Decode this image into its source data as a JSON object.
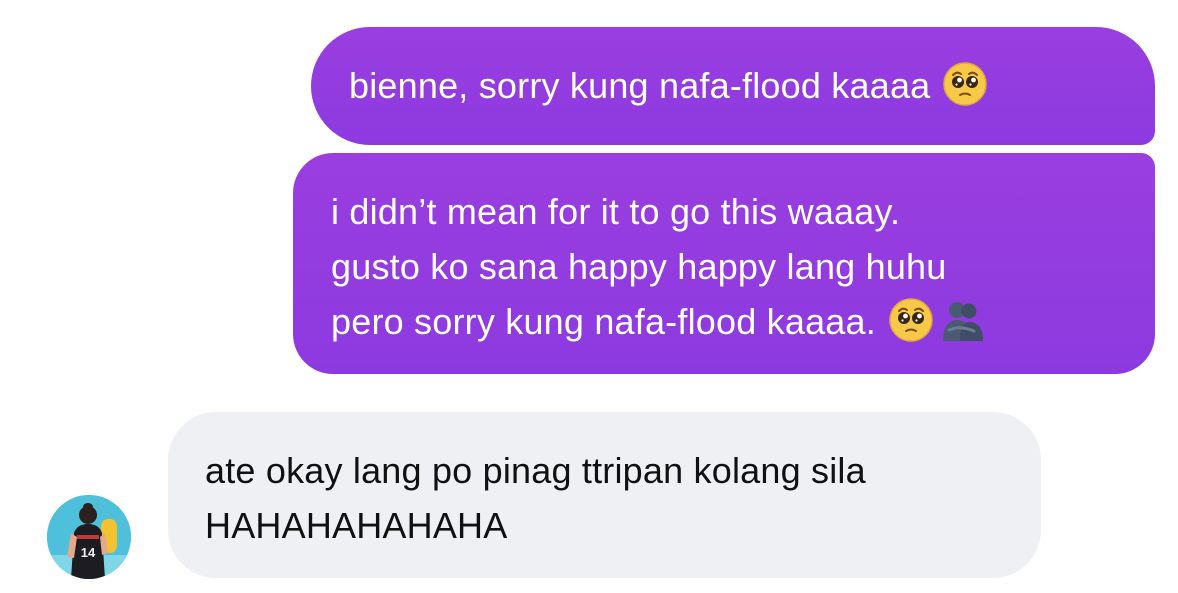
{
  "messages": [
    {
      "sender": "me",
      "lines": [
        "bienne, sorry kung nafa-flood kaaaa"
      ],
      "emoji": [
        "pleading-face"
      ]
    },
    {
      "sender": "me",
      "lines": [
        "i didn’t mean for it to go this waaay.",
        "gusto ko sana happy happy lang huhu",
        "pero sorry kung nafa-flood kaaaa."
      ],
      "emoji": [
        "pleading-face",
        "people-hugging"
      ]
    },
    {
      "sender": "other",
      "lines": [
        "ate okay lang po pinag ttripan kolang sila",
        "HAHAHAHAHAHA"
      ]
    }
  ],
  "colors": {
    "outgoing_bubble": "#8c3ae0",
    "incoming_bubble": "#eff0f4",
    "outgoing_text": "#ffffff",
    "incoming_text": "#111111",
    "avatar_background": "#4fc0dc"
  },
  "avatar": {
    "icon": "player-avatar-icon"
  }
}
